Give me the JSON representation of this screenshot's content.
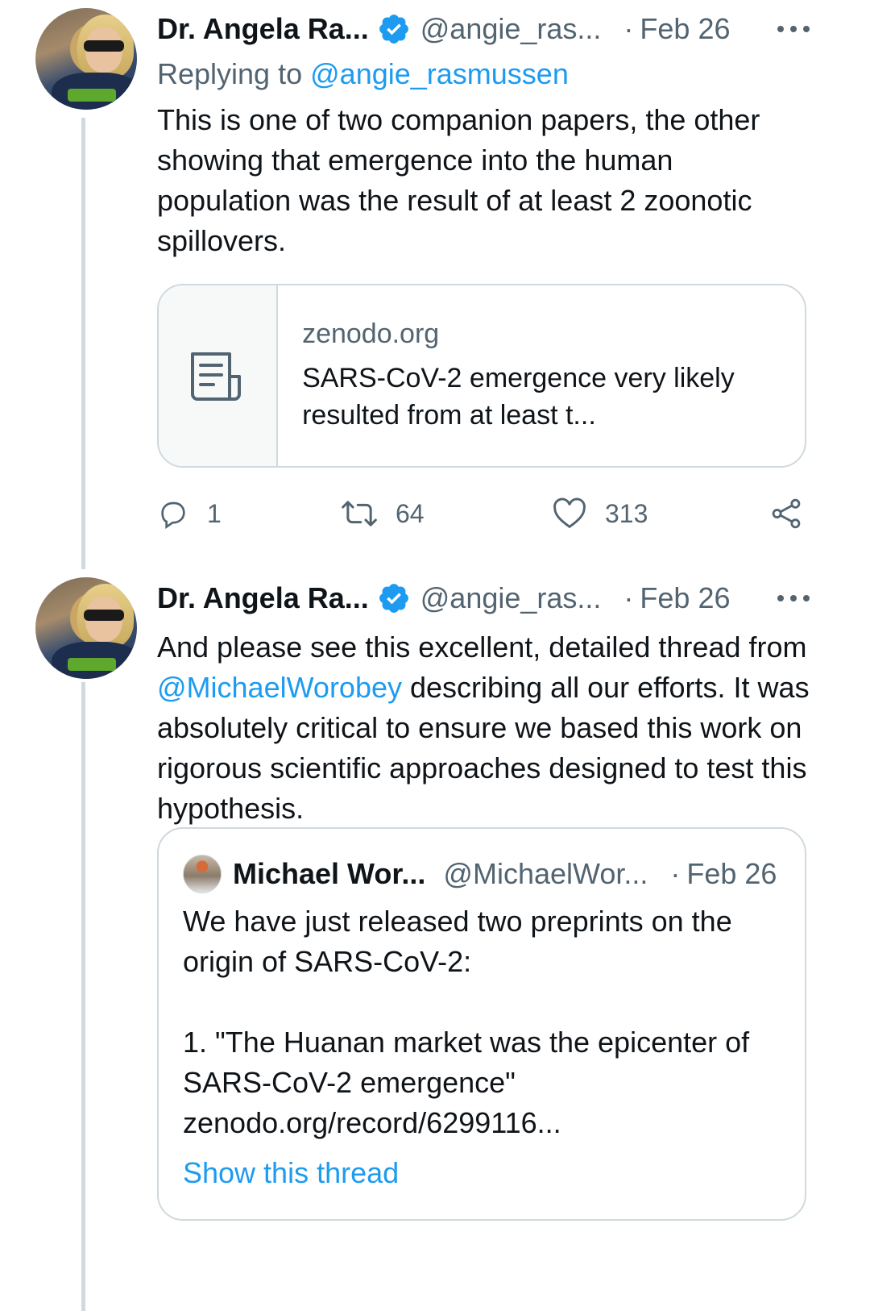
{
  "colors": {
    "accent": "#1d9bf0",
    "text_primary": "#0f1419",
    "text_secondary": "#536471",
    "border": "#cfd9de"
  },
  "tweets": [
    {
      "author_name": "Dr. Angela Ra...",
      "handle": "@angie_ras...",
      "dot": "·",
      "date": "Feb 26",
      "replying_prefix": "Replying to",
      "replying_handle": "@angie_rasmussen",
      "text": "This is one of two companion papers, the other showing that emergence into the human population was the result of at least 2 zoonotic spillovers.",
      "card": {
        "domain": "zenodo.org",
        "title": "SARS-CoV-2 emergence very likely resulted from at least t...",
        "icon": "document-icon"
      },
      "actions": {
        "replies": "1",
        "retweets": "64",
        "likes": "313"
      }
    },
    {
      "author_name": "Dr. Angela Ra...",
      "handle": "@angie_ras...",
      "dot": "·",
      "date": "Feb 26",
      "text_before_mention": "And please see this excellent, detailed thread from ",
      "mention": "@MichaelWorobey",
      "text_after_mention": " describing all our efforts. It was absolutely critical to ensure we based this work on rigorous scientific approaches designed to test this hypothesis.",
      "quote": {
        "author_name": "Michael Wor...",
        "handle": "@MichaelWor...",
        "dot": "·",
        "date": "Feb 26",
        "text": "We have just released two preprints on the origin of SARS-CoV-2:\n\n1. \"The Huanan market was the epicenter of SARS-CoV-2 emergence\"\nzenodo.org/record/6299116...",
        "show_thread": "Show this thread"
      }
    }
  ]
}
